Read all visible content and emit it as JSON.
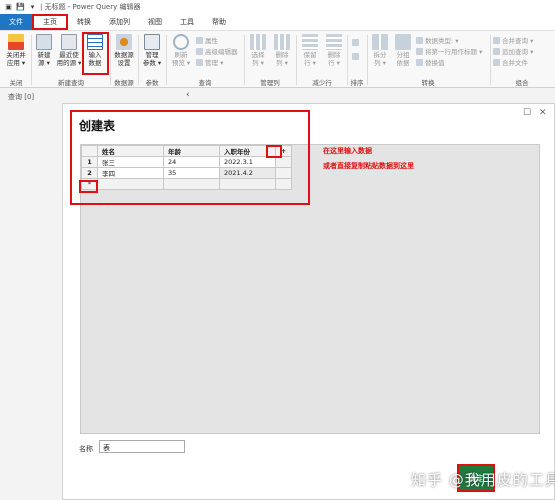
{
  "titlebar": {
    "title": "| 无标题 - Power Query 编辑器"
  },
  "menu": {
    "tabs": [
      "文件",
      "主页",
      "转换",
      "添加列",
      "视图",
      "工具",
      "帮助"
    ]
  },
  "ribbon": {
    "groups": {
      "close": "关闭",
      "new_query": "新建查询",
      "data_source": "数据源",
      "params": "参数",
      "query": "查询",
      "manage_cols": "管理列",
      "reduce_rows": "减少行",
      "sort": "排序",
      "transform": "转换",
      "combine": "组合"
    },
    "buttons": {
      "close_apply": [
        "关闭并",
        "应用 ▾"
      ],
      "new_source": [
        "新建",
        "源 ▾"
      ],
      "recent_sources": [
        "最近使",
        "用的源 ▾"
      ],
      "enter_data": [
        "输入",
        "数据"
      ],
      "ds_settings": [
        "数据源",
        "设置"
      ],
      "manage_params": [
        "管理",
        "参数 ▾"
      ],
      "refresh_preview": [
        "刷新",
        "预览 ▾"
      ],
      "properties": "属性",
      "advanced_editor": "高级编辑器",
      "manage": "管理 ▾",
      "choose_cols": [
        "选择",
        "列 ▾"
      ],
      "remove_cols": [
        "删除",
        "列 ▾"
      ],
      "keep_rows": [
        "保留",
        "行 ▾"
      ],
      "remove_rows": [
        "删除",
        "行 ▾"
      ],
      "split_col": [
        "拆分",
        "列 ▾"
      ],
      "group_by": [
        "分组",
        "依据"
      ],
      "data_type": "数据类型: ▾",
      "first_row_header": "将第一行用作标题 ▾",
      "replace_values": "替换值",
      "merge_queries": "合并查询 ▾",
      "append_queries": "追加查询 ▾",
      "combine_files": "合并文件"
    }
  },
  "query_pane": {
    "label": "查询 [0]",
    "collapse": "‹"
  },
  "dialog": {
    "title": "创建表",
    "maximize": "☐",
    "close": "✕",
    "columns": [
      "姓名",
      "年龄",
      "入职年份"
    ],
    "rows": [
      {
        "num": "1",
        "cells": [
          "张三",
          "24",
          "2022.3.1"
        ]
      },
      {
        "num": "2",
        "cells": [
          "李四",
          "35",
          "2021.4.2"
        ]
      }
    ],
    "add_col": "+",
    "add_row": "*",
    "note1": "在这里输入数据",
    "note2": "或者直接复制粘贴数据到这里",
    "name_label": "名称",
    "name_value": "表",
    "ok_label": "确定"
  },
  "watermark": "知乎 @我用皮的工具"
}
